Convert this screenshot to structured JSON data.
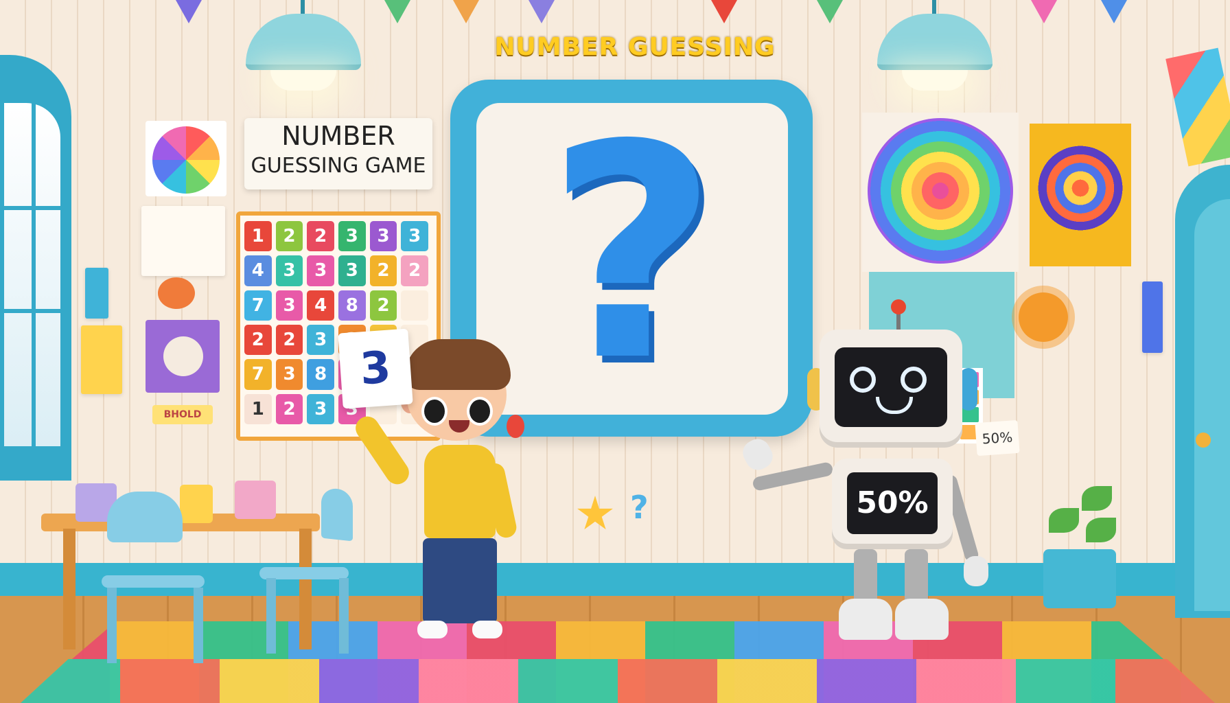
{
  "scene": {
    "header_title": "NUMBER GUESSING",
    "sign_line1": "NUMBER",
    "sign_line2": "GUESSING GAME",
    "board_symbol": "?",
    "guess_card_value": "3",
    "robot_display": "50%",
    "wall_tag": "50%",
    "small_label": "BHOLD"
  },
  "number_chart": [
    {
      "v": "1",
      "c": "#e8473a"
    },
    {
      "v": "2",
      "c": "#8dc63f"
    },
    {
      "v": "2",
      "c": "#e84a5f"
    },
    {
      "v": "3",
      "c": "#35b56e"
    },
    {
      "v": "3",
      "c": "#9b59d0"
    },
    {
      "v": "3",
      "c": "#3fb3d8"
    },
    {
      "v": "4",
      "c": "#5a8de0"
    },
    {
      "v": "3",
      "c": "#36c1a6"
    },
    {
      "v": "3",
      "c": "#e85aa8"
    },
    {
      "v": "3",
      "c": "#2fb08f"
    },
    {
      "v": "2",
      "c": "#f2b22a"
    },
    {
      "v": "2",
      "c": "#f4a2c0"
    },
    {
      "v": "7",
      "c": "#41b3e3"
    },
    {
      "v": "3",
      "c": "#e85aa8"
    },
    {
      "v": "4",
      "c": "#e8473a"
    },
    {
      "v": "8",
      "c": "#9a71e0"
    },
    {
      "v": "2",
      "c": "#8dc63f"
    },
    {
      "v": "",
      "c": "#fbeedf"
    },
    {
      "v": "2",
      "c": "#e8473a"
    },
    {
      "v": "2",
      "c": "#e8473a"
    },
    {
      "v": "3",
      "c": "#3fb3d8"
    },
    {
      "v": "3",
      "c": "#f08a2e"
    },
    {
      "v": "4",
      "c": "#f4c339"
    },
    {
      "v": "",
      "c": "#fbeedf"
    },
    {
      "v": "7",
      "c": "#f2b22a"
    },
    {
      "v": "3",
      "c": "#f08a2e"
    },
    {
      "v": "8",
      "c": "#3f9fe0"
    },
    {
      "v": "3",
      "c": "#e85aa8"
    },
    {
      "v": "",
      "c": "#fbeedf"
    },
    {
      "v": "",
      "c": "#fbeedf"
    },
    {
      "v": "1",
      "c": "#f7e2d6"
    },
    {
      "v": "2",
      "c": "#e85aa8"
    },
    {
      "v": "3",
      "c": "#3fb3d8"
    },
    {
      "v": "3",
      "c": "#e85aa8"
    },
    {
      "v": "",
      "c": "#fbeedf"
    },
    {
      "v": "",
      "c": "#fbeedf"
    }
  ],
  "small_grid_colors": [
    "#ff5b6b",
    "#36c1a6",
    "#ffd34d",
    "#f06ab2",
    "#4fa3ee",
    "#e8473a",
    "#6fd26b",
    "#ffb34a",
    "#9d5be8",
    "#ff86a0",
    "#ffd34d",
    "#35c28d",
    "#e8473a",
    "#f08a2e",
    "#4aa5ee",
    "#ffb34a"
  ],
  "bunting_colors": [
    "#7a6ce0",
    "#58c07a",
    "#f0a34a",
    "#8a7fe0",
    "#e8473a",
    "#58c07a",
    "#f06ab2",
    "#4f8fe8"
  ],
  "icons": {
    "board": "question-mark-icon",
    "robot": "robot-icon",
    "child": "child-icon"
  },
  "colors": {
    "accent": "#41b1d9",
    "title": "#ffcc22",
    "question": "#2f8fe8"
  }
}
